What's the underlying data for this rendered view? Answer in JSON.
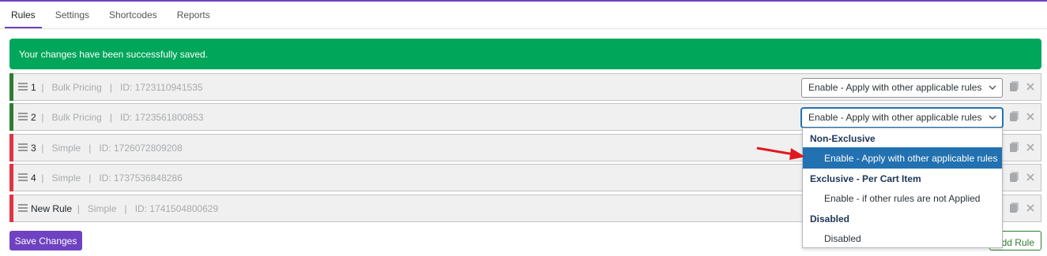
{
  "tabs": [
    {
      "label": "Rules",
      "active": true
    },
    {
      "label": "Settings",
      "active": false
    },
    {
      "label": "Shortcodes",
      "active": false
    },
    {
      "label": "Reports",
      "active": false
    }
  ],
  "notice": "Your changes have been successfully saved.",
  "rules": [
    {
      "num": "1",
      "separator": "|",
      "type": "Bulk Pricing",
      "id": "ID: 1723110941535",
      "status": "green",
      "select_value": "Enable - Apply with other applicable rules"
    },
    {
      "num": "2",
      "separator": "|",
      "type": "Bulk Pricing",
      "id": "ID: 1723561800853",
      "status": "green",
      "select_value": "Enable - Apply with other applicable rules"
    },
    {
      "num": "3",
      "separator": "|",
      "type": "Simple",
      "id": "ID: 1726072809208",
      "status": "red"
    },
    {
      "num": "4",
      "separator": "|",
      "type": "Simple",
      "id": "ID: 1737536848286",
      "status": "red"
    },
    {
      "num": "New Rule",
      "separator": "|",
      "type": "Simple",
      "id": "ID: 1741504800629",
      "status": "red"
    }
  ],
  "dropdown": {
    "groups": [
      {
        "label": "Non-Exclusive",
        "options": [
          {
            "label": "Enable - Apply with other applicable rules",
            "selected": true
          }
        ]
      },
      {
        "label": "Exclusive - Per Cart Item",
        "options": [
          {
            "label": "Enable - if other rules are not Applied",
            "selected": false
          }
        ]
      },
      {
        "label": "Disabled",
        "options": [
          {
            "label": "Disabled",
            "selected": false
          }
        ]
      }
    ]
  },
  "buttons": {
    "save": "Save Changes",
    "add_rule": "Add Rule"
  },
  "colors": {
    "accent": "#6f42c1",
    "success": "#00a65a",
    "enabled_bar": "#2e7d32",
    "disabled_bar": "#dc3545",
    "selected_option": "#2271b1",
    "annotation_arrow": "#e0191e"
  },
  "icons": [
    "drag-handle-icon",
    "chevron-down-icon",
    "copy-icon",
    "close-icon",
    "red-arrow-annotation"
  ]
}
